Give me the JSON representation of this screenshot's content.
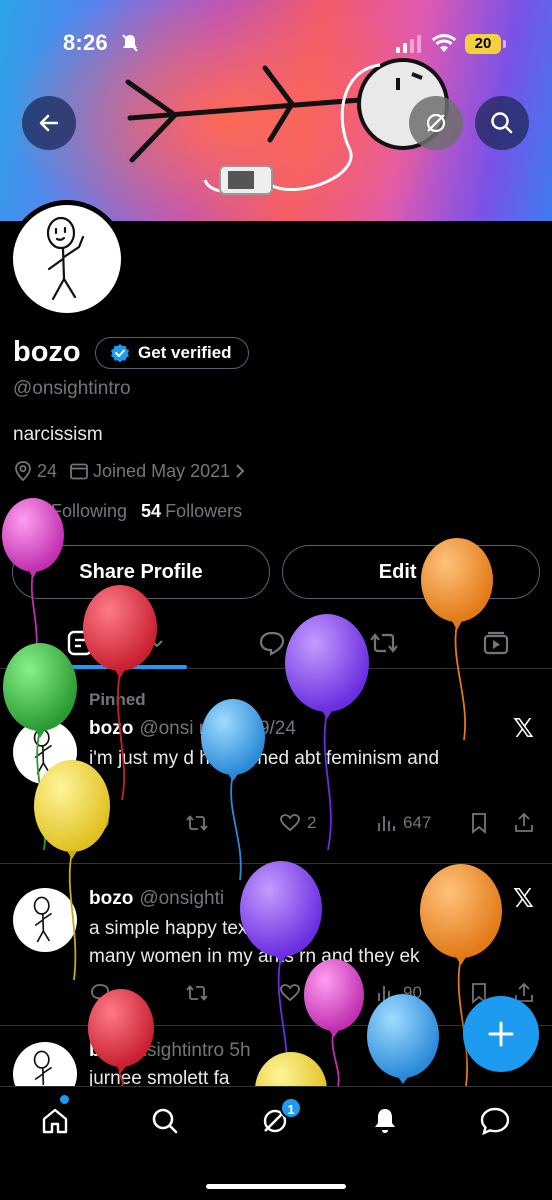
{
  "status_bar": {
    "time": "8:26",
    "battery": "20"
  },
  "profile": {
    "display_name": "bozo",
    "verify_label": "Get verified",
    "handle": "@onsightintro",
    "bio": "narcissism",
    "location": "24",
    "joined": "Joined May 2021",
    "following_label": "Following",
    "followers_count": "54",
    "followers_label": "Followers",
    "share_label": "Share Profile",
    "edit_label": "Edit Pr"
  },
  "posts": [
    {
      "pinned_label": "Pinned",
      "name": "bozo",
      "handle_date": "@onsi     ro · 4/29/24",
      "text": "i'm just my d        he learned abt feminism and",
      "text2": "t",
      "retweets": "",
      "likes": "2",
      "views": "647"
    },
    {
      "name": "bozo",
      "handle_date": "@onsighti",
      "text": "a simple happy              text woul",
      "text2": "many women in my  ants rn and they  ek",
      "views": "90"
    },
    {
      "name": "b",
      "handle_date": "@onsightintro  5h",
      "text": "jurnee smolett fa"
    }
  ],
  "nav": {
    "messages_badge": "1"
  },
  "colors": {
    "accent": "#1d9bf0",
    "muted": "#71767b",
    "border": "#2f3336"
  }
}
